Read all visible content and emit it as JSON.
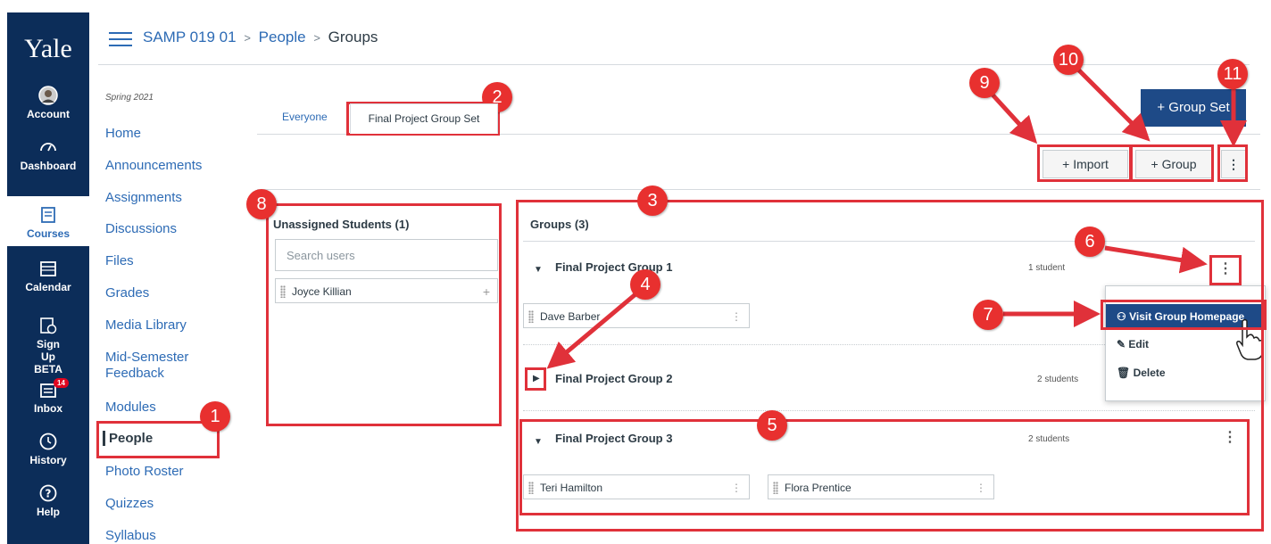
{
  "global_nav": {
    "logo": "Yale",
    "items": [
      {
        "label": "Account",
        "icon": "account-avatar"
      },
      {
        "label": "Dashboard",
        "icon": "dashboard-icon"
      },
      {
        "label": "Courses",
        "icon": "courses-icon"
      },
      {
        "label": "Calendar",
        "icon": "calendar-icon"
      },
      {
        "label": "Sign Up BETA",
        "icon": "signup-icon"
      },
      {
        "label": "Inbox",
        "icon": "inbox-icon",
        "badge": "14"
      },
      {
        "label": "History",
        "icon": "history-icon"
      },
      {
        "label": "Help",
        "icon": "help-icon"
      }
    ]
  },
  "breadcrumb": {
    "course": "SAMP 019 01",
    "section": "People",
    "page": "Groups",
    "separator": ">"
  },
  "course_nav": {
    "term": "Spring 2021",
    "items": [
      "Home",
      "Announcements",
      "Assignments",
      "Discussions",
      "Files",
      "Grades",
      "Media Library",
      "Mid-Semester Feedback",
      "Modules",
      "People",
      "Photo Roster",
      "Quizzes",
      "Syllabus"
    ],
    "current": "People"
  },
  "tabs": {
    "everyone": "Everyone",
    "group_set": "Final Project Group Set"
  },
  "buttons": {
    "add_group_set": "+ Group Set",
    "import": "+ Import",
    "add_group": "+ Group",
    "more": "⋮"
  },
  "unassigned": {
    "title": "Unassigned Students (1)",
    "search_placeholder": "Search users",
    "students": [
      "Joyce Killian"
    ],
    "add_icon": "+"
  },
  "groups": {
    "title": "Groups (3)",
    "list": [
      {
        "name": "Final Project Group 1",
        "count": "1 student",
        "members": [
          "Dave Barber"
        ]
      },
      {
        "name": "Final Project Group 2",
        "count": "2 students",
        "members": []
      },
      {
        "name": "Final Project Group 3",
        "count": "2 students",
        "members": [
          "Teri Hamilton",
          "Flora Prentice"
        ]
      }
    ]
  },
  "group_menu": {
    "visit": "Visit Group Homepage",
    "edit": "Edit",
    "delete": "Delete"
  },
  "annotations": [
    "1",
    "2",
    "3",
    "4",
    "5",
    "6",
    "7",
    "8",
    "9",
    "10",
    "11"
  ],
  "colors": {
    "nav_bg": "#0c2d59",
    "link": "#2d6bb5",
    "primary": "#1e4a87",
    "annotation": "#e0313a"
  }
}
